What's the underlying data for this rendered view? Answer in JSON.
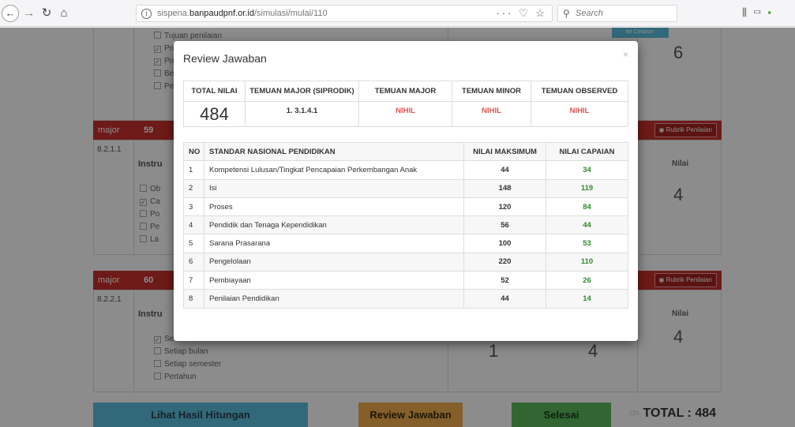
{
  "browser": {
    "url_prefix": "sispena.",
    "url_domain": "banpaudpnf.or.id",
    "url_path": "/simulasi/mulai/110",
    "url_actions": "··· ♡ ☆",
    "search_placeholder": "Search"
  },
  "background": {
    "section0": {
      "options": [
        "Tujuan penilaian",
        "Pri",
        "Pro",
        "Be",
        "Per"
      ],
      "checked": [
        false,
        true,
        true,
        false,
        false
      ],
      "nilai_value": "6",
      "small_button_label": "ke Cetakan"
    },
    "section1": {
      "label": "major",
      "number": "59",
      "rubrik_label": "Rubrik Penilaian",
      "code": "8.2.1.1",
      "instru_label": "Instru",
      "nilai_header": "Nilai",
      "nilai_value": "4",
      "options": [
        "Ob",
        "Ca",
        "Po",
        "Pe",
        "La"
      ],
      "checked": [
        false,
        true,
        false,
        false,
        false
      ]
    },
    "section2": {
      "label": "major",
      "number": "60",
      "rubrik_label": "Rubrik Penilaian",
      "code": "8.2.2.1",
      "instru_label": "Instru",
      "nilai_header": "Nilai",
      "nilai_value": "4",
      "options": [
        "Se",
        "Setiap bulan",
        "Setiap semester",
        "Pertahun"
      ],
      "checked": [
        true,
        false,
        false,
        false
      ],
      "score_left": "1",
      "score_right": "4"
    },
    "bottom": {
      "hasil_label": "Lihat Hasil Hitungan",
      "review_label": "Review Jawaban",
      "selesai_label": "Selesai",
      "total_label": "TOTAL : 484"
    }
  },
  "modal": {
    "title": "Review Jawaban",
    "summary_headers": [
      "TOTAL NILAI",
      "TEMUAN MAJOR (SIPRODIK)",
      "TEMUAN MAJOR",
      "TEMUAN MINOR",
      "TEMUAN OBSERVED"
    ],
    "summary_values": {
      "total_nilai": "484",
      "temuan_major_siprodik": "1. 3.1.4.1",
      "temuan_major": "NIHIL",
      "temuan_minor": "NIHIL",
      "temuan_observed": "NIHIL"
    },
    "standar_headers": [
      "NO",
      "STANDAR NASIONAL PENDIDIKAN",
      "NILAI MAKSIMUM",
      "NILAI CAPAIAN"
    ],
    "standar_rows": [
      {
        "no": "1",
        "name": "Kompetensi Lulusan/Tingkat Pencapaian Perkembangan Anak",
        "max": "44",
        "capaian": "34"
      },
      {
        "no": "2",
        "name": "Isi",
        "max": "148",
        "capaian": "119"
      },
      {
        "no": "3",
        "name": "Proses",
        "max": "120",
        "capaian": "84"
      },
      {
        "no": "4",
        "name": "Pendidik dan Tenaga Kependidikan",
        "max": "56",
        "capaian": "44"
      },
      {
        "no": "5",
        "name": "Sarana Prasarana",
        "max": "100",
        "capaian": "53"
      },
      {
        "no": "6",
        "name": "Pengelolaan",
        "max": "220",
        "capaian": "110"
      },
      {
        "no": "7",
        "name": "Pembiayaan",
        "max": "52",
        "capaian": "26"
      },
      {
        "no": "8",
        "name": "Penilaian Pendidikan",
        "max": "44",
        "capaian": "14"
      }
    ]
  }
}
